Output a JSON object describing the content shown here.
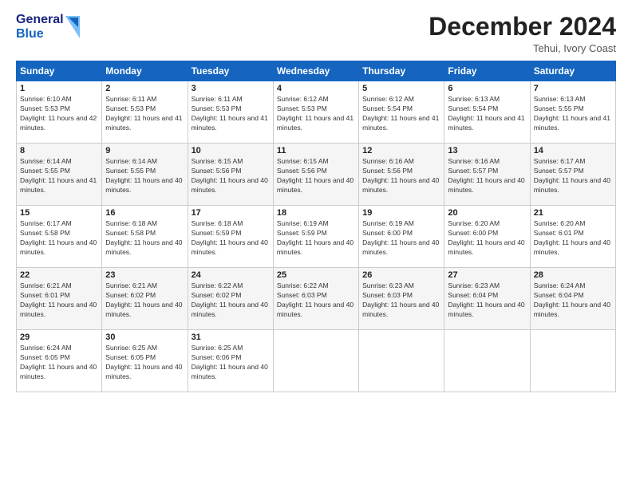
{
  "header": {
    "logo_line1": "General",
    "logo_line2": "Blue",
    "title": "December 2024",
    "location": "Tehui, Ivory Coast"
  },
  "weekdays": [
    "Sunday",
    "Monday",
    "Tuesday",
    "Wednesday",
    "Thursday",
    "Friday",
    "Saturday"
  ],
  "weeks": [
    [
      {
        "day": "1",
        "sunrise": "6:10 AM",
        "sunset": "5:53 PM",
        "daylight": "11 hours and 42 minutes."
      },
      {
        "day": "2",
        "sunrise": "6:11 AM",
        "sunset": "5:53 PM",
        "daylight": "11 hours and 41 minutes."
      },
      {
        "day": "3",
        "sunrise": "6:11 AM",
        "sunset": "5:53 PM",
        "daylight": "11 hours and 41 minutes."
      },
      {
        "day": "4",
        "sunrise": "6:12 AM",
        "sunset": "5:53 PM",
        "daylight": "11 hours and 41 minutes."
      },
      {
        "day": "5",
        "sunrise": "6:12 AM",
        "sunset": "5:54 PM",
        "daylight": "11 hours and 41 minutes."
      },
      {
        "day": "6",
        "sunrise": "6:13 AM",
        "sunset": "5:54 PM",
        "daylight": "11 hours and 41 minutes."
      },
      {
        "day": "7",
        "sunrise": "6:13 AM",
        "sunset": "5:55 PM",
        "daylight": "11 hours and 41 minutes."
      }
    ],
    [
      {
        "day": "8",
        "sunrise": "6:14 AM",
        "sunset": "5:55 PM",
        "daylight": "11 hours and 41 minutes."
      },
      {
        "day": "9",
        "sunrise": "6:14 AM",
        "sunset": "5:55 PM",
        "daylight": "11 hours and 40 minutes."
      },
      {
        "day": "10",
        "sunrise": "6:15 AM",
        "sunset": "5:56 PM",
        "daylight": "11 hours and 40 minutes."
      },
      {
        "day": "11",
        "sunrise": "6:15 AM",
        "sunset": "5:56 PM",
        "daylight": "11 hours and 40 minutes."
      },
      {
        "day": "12",
        "sunrise": "6:16 AM",
        "sunset": "5:56 PM",
        "daylight": "11 hours and 40 minutes."
      },
      {
        "day": "13",
        "sunrise": "6:16 AM",
        "sunset": "5:57 PM",
        "daylight": "11 hours and 40 minutes."
      },
      {
        "day": "14",
        "sunrise": "6:17 AM",
        "sunset": "5:57 PM",
        "daylight": "11 hours and 40 minutes."
      }
    ],
    [
      {
        "day": "15",
        "sunrise": "6:17 AM",
        "sunset": "5:58 PM",
        "daylight": "11 hours and 40 minutes."
      },
      {
        "day": "16",
        "sunrise": "6:18 AM",
        "sunset": "5:58 PM",
        "daylight": "11 hours and 40 minutes."
      },
      {
        "day": "17",
        "sunrise": "6:18 AM",
        "sunset": "5:59 PM",
        "daylight": "11 hours and 40 minutes."
      },
      {
        "day": "18",
        "sunrise": "6:19 AM",
        "sunset": "5:59 PM",
        "daylight": "11 hours and 40 minutes."
      },
      {
        "day": "19",
        "sunrise": "6:19 AM",
        "sunset": "6:00 PM",
        "daylight": "11 hours and 40 minutes."
      },
      {
        "day": "20",
        "sunrise": "6:20 AM",
        "sunset": "6:00 PM",
        "daylight": "11 hours and 40 minutes."
      },
      {
        "day": "21",
        "sunrise": "6:20 AM",
        "sunset": "6:01 PM",
        "daylight": "11 hours and 40 minutes."
      }
    ],
    [
      {
        "day": "22",
        "sunrise": "6:21 AM",
        "sunset": "6:01 PM",
        "daylight": "11 hours and 40 minutes."
      },
      {
        "day": "23",
        "sunrise": "6:21 AM",
        "sunset": "6:02 PM",
        "daylight": "11 hours and 40 minutes."
      },
      {
        "day": "24",
        "sunrise": "6:22 AM",
        "sunset": "6:02 PM",
        "daylight": "11 hours and 40 minutes."
      },
      {
        "day": "25",
        "sunrise": "6:22 AM",
        "sunset": "6:03 PM",
        "daylight": "11 hours and 40 minutes."
      },
      {
        "day": "26",
        "sunrise": "6:23 AM",
        "sunset": "6:03 PM",
        "daylight": "11 hours and 40 minutes."
      },
      {
        "day": "27",
        "sunrise": "6:23 AM",
        "sunset": "6:04 PM",
        "daylight": "11 hours and 40 minutes."
      },
      {
        "day": "28",
        "sunrise": "6:24 AM",
        "sunset": "6:04 PM",
        "daylight": "11 hours and 40 minutes."
      }
    ],
    [
      {
        "day": "29",
        "sunrise": "6:24 AM",
        "sunset": "6:05 PM",
        "daylight": "11 hours and 40 minutes."
      },
      {
        "day": "30",
        "sunrise": "6:25 AM",
        "sunset": "6:05 PM",
        "daylight": "11 hours and 40 minutes."
      },
      {
        "day": "31",
        "sunrise": "6:25 AM",
        "sunset": "6:06 PM",
        "daylight": "11 hours and 40 minutes."
      },
      null,
      null,
      null,
      null
    ]
  ]
}
